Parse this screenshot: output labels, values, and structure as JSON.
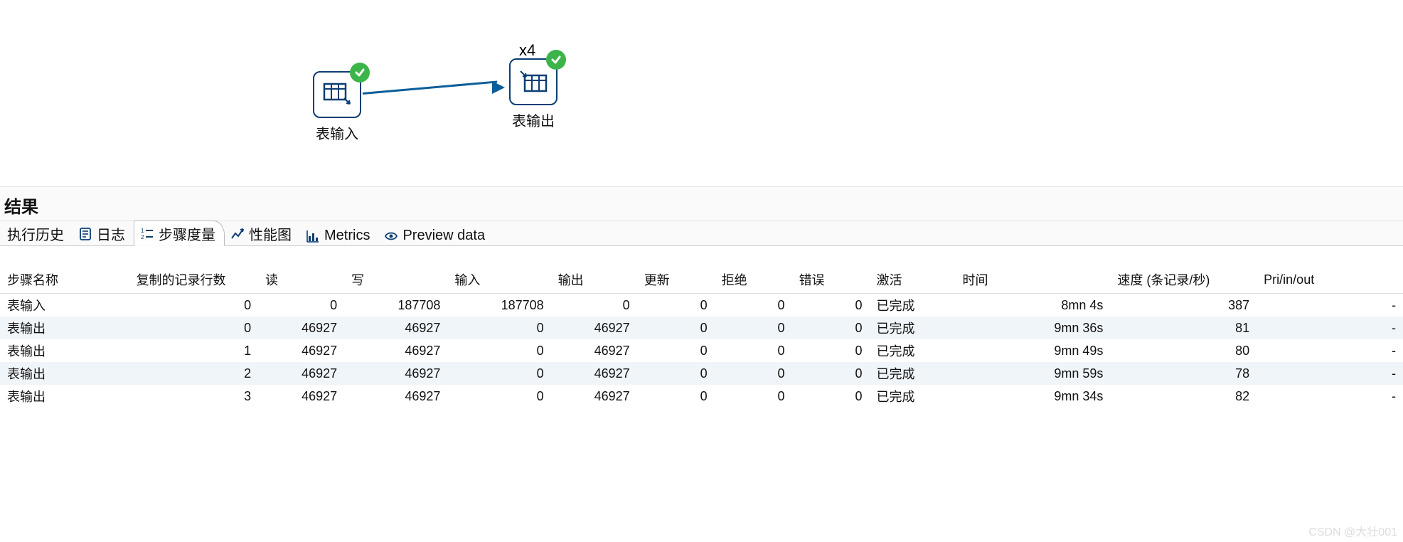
{
  "diagram": {
    "multiplicity_label": "x4",
    "node_input": {
      "label": "表输入"
    },
    "node_output": {
      "label": "表输出"
    }
  },
  "section_title": "结果",
  "tabs": {
    "history": "执行历史",
    "log": "日志",
    "metrics_step": "步骤度量",
    "perf": "性能图",
    "metrics": "Metrics",
    "preview": "Preview data"
  },
  "columns": {
    "step_name": "步骤名称",
    "copied_rows": "复制的记录行数",
    "read": "读",
    "write": "写",
    "input": "输入",
    "output": "输出",
    "update": "更新",
    "reject": "拒绝",
    "error": "错误",
    "active": "激活",
    "time": "时间",
    "speed": "速度 (条记录/秒)",
    "pri": "Pri/in/out"
  },
  "rows": [
    {
      "step_name": "表输入",
      "copied_rows": "0",
      "read": "0",
      "write": "187708",
      "input": "187708",
      "output": "0",
      "update": "0",
      "reject": "0",
      "error": "0",
      "active": "已完成",
      "time": "8mn 4s",
      "speed": "387",
      "pri": "-"
    },
    {
      "step_name": "表输出",
      "copied_rows": "0",
      "read": "46927",
      "write": "46927",
      "input": "0",
      "output": "46927",
      "update": "0",
      "reject": "0",
      "error": "0",
      "active": "已完成",
      "time": "9mn 36s",
      "speed": "81",
      "pri": "-"
    },
    {
      "step_name": "表输出",
      "copied_rows": "1",
      "read": "46927",
      "write": "46927",
      "input": "0",
      "output": "46927",
      "update": "0",
      "reject": "0",
      "error": "0",
      "active": "已完成",
      "time": "9mn 49s",
      "speed": "80",
      "pri": "-"
    },
    {
      "step_name": "表输出",
      "copied_rows": "2",
      "read": "46927",
      "write": "46927",
      "input": "0",
      "output": "46927",
      "update": "0",
      "reject": "0",
      "error": "0",
      "active": "已完成",
      "time": "9mn 59s",
      "speed": "78",
      "pri": "-"
    },
    {
      "step_name": "表输出",
      "copied_rows": "3",
      "read": "46927",
      "write": "46927",
      "input": "0",
      "output": "46927",
      "update": "0",
      "reject": "0",
      "error": "0",
      "active": "已完成",
      "time": "9mn 34s",
      "speed": "82",
      "pri": "-"
    }
  ],
  "watermark": "CSDN @大壮001"
}
